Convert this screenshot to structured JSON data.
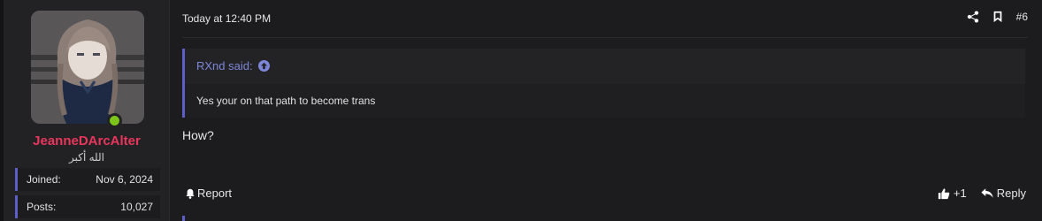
{
  "user": {
    "username": "JeanneDArcAlter",
    "title": "الله أكبر",
    "online": true,
    "stats": [
      {
        "label": "Joined:",
        "value": "Nov 6, 2024"
      },
      {
        "label": "Posts:",
        "value": "10,027"
      }
    ]
  },
  "post": {
    "timestamp": "Today at 12:40 PM",
    "number": "#6",
    "quote": {
      "author": "RXnd said:",
      "text": "Yes your on that path to become trans"
    },
    "message": "How?",
    "footer": {
      "report_label": "Report",
      "reaction_count": "+1",
      "reply_label": "Reply"
    }
  },
  "colors": {
    "username": "#e8365d",
    "accent": "#5b5fc7",
    "online": "#7cc31a",
    "background": "#1c1c1e"
  },
  "icons": [
    "share-icon",
    "bookmark-icon",
    "arrow-up-circle-icon",
    "bell-icon",
    "thumbs-up-icon",
    "reply-icon"
  ]
}
